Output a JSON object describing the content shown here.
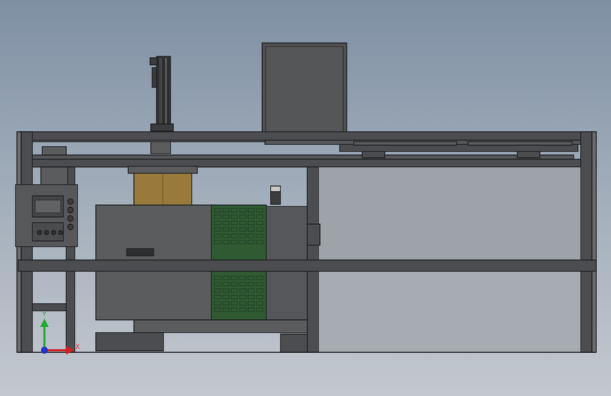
{
  "viewport": {
    "background_top": "#7f90a4",
    "background_bottom": "#c3c8cf",
    "render_mode": "shaded-with-edges"
  },
  "colors": {
    "frame": "#4b4d50",
    "frame_edge": "#1e1f21",
    "housing": "#5a5c5e",
    "panel": "#56585a",
    "vent_green": "#2f5a32",
    "cardboard": "#9a7a3c"
  },
  "triad": {
    "x_label": "X",
    "y_label": "Y",
    "x_color": "#cc2222",
    "y_color": "#22aa33",
    "origin_color": "#2233cc"
  }
}
